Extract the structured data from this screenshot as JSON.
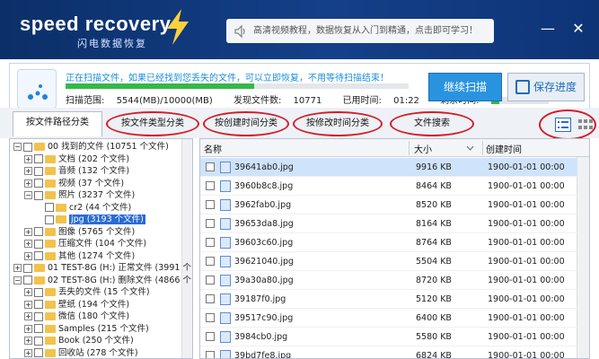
{
  "app": {
    "logo": "speed recovery",
    "subtitle": "闪电数据恢复"
  },
  "help": {
    "text": "高清视频教程，数据恢复从入门到精通，点击即可学习！"
  },
  "window": {
    "minimize": "—",
    "close": "✕"
  },
  "status": {
    "message": "正在扫描文件，如果已经找到您丢失的文件，可以立即恢复，不用等待扫描结束！",
    "progress": 0.55,
    "scanned_label": "扫描范围:",
    "scanned_value": "5544(MB)/10000(MB)",
    "found_label": "发现文件数:",
    "found_value": "10771",
    "used_label": "已用时间:",
    "used_value": "01:22",
    "remain_label": "剩余时间:",
    "remain_progress": 0.15
  },
  "buttons": {
    "scan": "继续扫描",
    "save": "保存进度"
  },
  "tabs": [
    "按文件路径分类",
    "按文件类型分类",
    "按创建时间分类",
    "按修改时间分类",
    "文件搜索"
  ],
  "tree": [
    {
      "pm": "−",
      "label": "00 找到的文件",
      "count": "(10751 个文件)",
      "level": 0
    },
    {
      "pm": "+",
      "label": "文档",
      "count": "(202 个文件)",
      "level": 1
    },
    {
      "pm": "+",
      "label": "音频",
      "count": "(132 个文件)",
      "level": 1
    },
    {
      "pm": "+",
      "label": "视频",
      "count": "(37 个文件)",
      "level": 1
    },
    {
      "pm": "−",
      "label": "照片",
      "count": "(3237 个文件)",
      "level": 1
    },
    {
      "pm": "",
      "label": "cr2",
      "count": "(44 个文件)",
      "level": 2
    },
    {
      "pm": "",
      "label": "jpg",
      "count": "(3193 个文件)",
      "level": 2,
      "selected": true
    },
    {
      "pm": "+",
      "label": "图像",
      "count": "(5765 个文件)",
      "level": 1
    },
    {
      "pm": "+",
      "label": "压缩文件",
      "count": "(104 个文件)",
      "level": 1
    },
    {
      "pm": "+",
      "label": "其他",
      "count": "(1274 个文件)",
      "level": 1
    },
    {
      "pm": "+",
      "label": "01 TEST-8G (H:) 正常文件",
      "count": "(3991 个",
      "level": 0
    },
    {
      "pm": "−",
      "label": "02 TEST-8G (H:) 删除文件",
      "count": "(4866 个",
      "level": 0
    },
    {
      "pm": "+",
      "label": "丢失的文件",
      "count": "(15 个文件)",
      "level": 1
    },
    {
      "pm": "+",
      "label": "壁纸",
      "count": "(194 个文件)",
      "level": 1
    },
    {
      "pm": "+",
      "label": "微信",
      "count": "(180 个文件)",
      "level": 1
    },
    {
      "pm": "+",
      "label": "Samples",
      "count": "(215 个文件)",
      "level": 1
    },
    {
      "pm": "+",
      "label": "Book",
      "count": "(250 个文件)",
      "level": 1
    },
    {
      "pm": "+",
      "label": "回收站",
      "count": "(278 个文件)",
      "level": 1
    }
  ],
  "table": {
    "headers": {
      "name": "名称",
      "size": "大小",
      "created": "创建时间"
    },
    "rows": [
      {
        "name": "39641ab0.jpg",
        "size": "9916 KB",
        "created": "1900-01-01 00:00",
        "hl": true
      },
      {
        "name": "3960b8c8.jpg",
        "size": "8464 KB",
        "created": "1900-01-01 00:00"
      },
      {
        "name": "3962fab0.jpg",
        "size": "8520 KB",
        "created": "1900-01-01 00:00"
      },
      {
        "name": "39653da8.jpg",
        "size": "8164 KB",
        "created": "1900-01-01 00:00"
      },
      {
        "name": "39603c60.jpg",
        "size": "8764 KB",
        "created": "1900-01-01 00:00"
      },
      {
        "name": "39621040.jpg",
        "size": "5504 KB",
        "created": "1900-01-01 00:00"
      },
      {
        "name": "39a30a80.jpg",
        "size": "8720 KB",
        "created": "1900-01-01 00:00"
      },
      {
        "name": "39187f0.jpg",
        "size": "5120 KB",
        "created": "1900-01-01 00:00"
      },
      {
        "name": "39517c90.jpg",
        "size": "6400 KB",
        "created": "1900-01-01 00:00"
      },
      {
        "name": "3984cb0.jpg",
        "size": "5580 KB",
        "created": "1900-01-01 00:00"
      },
      {
        "name": "39bd7fe8.jpg",
        "size": "6824 KB",
        "created": "1900-01-01 00:00"
      }
    ]
  }
}
